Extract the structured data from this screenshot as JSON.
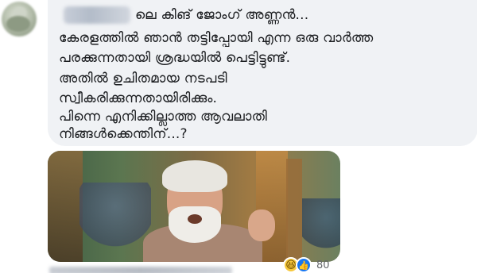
{
  "comment": {
    "text_lines": [
      "ലെ കിങ് ജോംഗ് അണ്ണൻ...",
      "കേരളത്തിൽ ഞാൻ തട്ടിപ്പോയി എന്ന ഒരു വാർത്ത",
      "പരക്കുന്നതായി ശ്രദ്ധയിൽ പെട്ടിട്ടുണ്ട്.",
      "അതിൽ ഉചിതമായ നടപടി",
      "സ്വീകരിക്കുന്നതായിരിക്കും.",
      "പിന്നെ എനിക്കില്ലാത്ത ആവലാതി",
      "നിങ്ങൾക്കെന്തിന്...?"
    ]
  },
  "reactions": {
    "icons": [
      "haha-icon",
      "like-icon"
    ],
    "count": "80"
  },
  "colors": {
    "bubble_bg": "#f0f2f5",
    "text": "#1c1e21",
    "like_blue": "#1877f2",
    "haha_yellow": "#f7c83b"
  }
}
